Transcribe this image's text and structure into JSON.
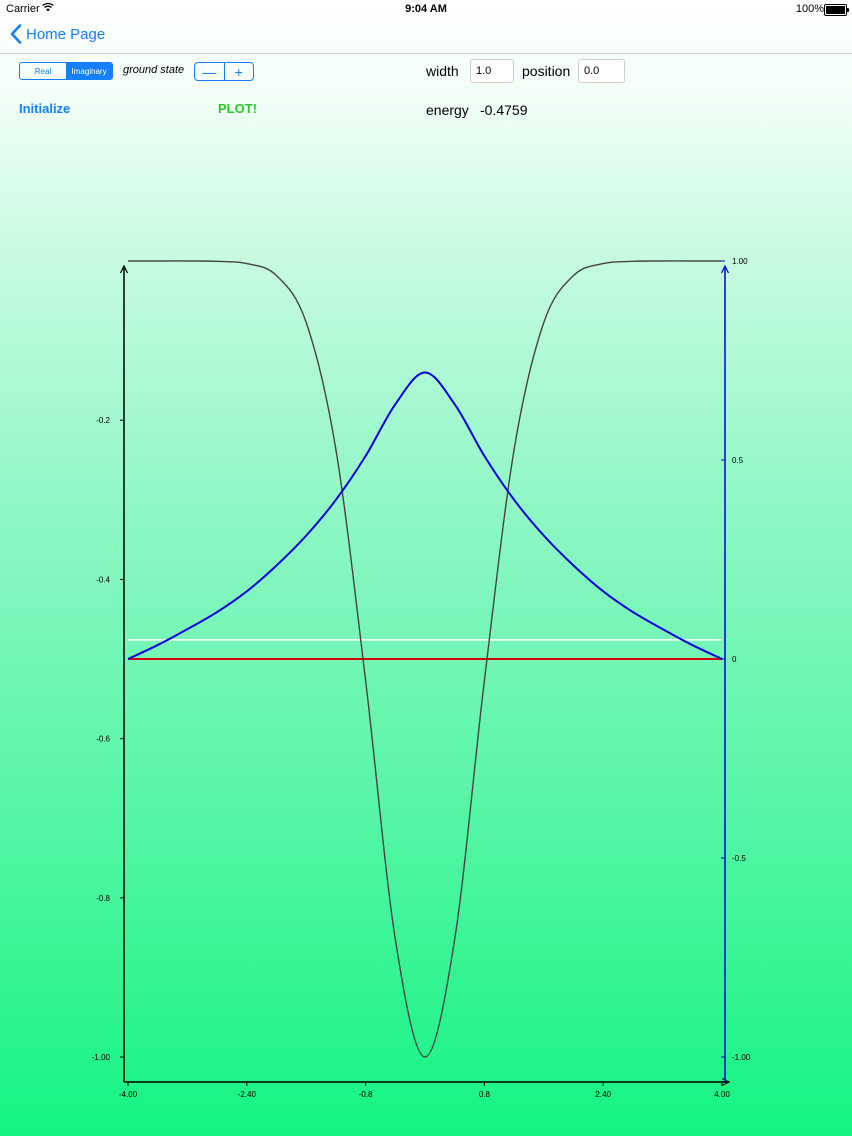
{
  "status_bar": {
    "carrier": "Carrier",
    "time": "9:04 AM",
    "battery": "100%"
  },
  "nav": {
    "back_label": "Home Page"
  },
  "controls": {
    "segment_real": "Real",
    "segment_imaginary": "Imaginary",
    "selected_segment": "Imaginary",
    "ground_state_label": "ground state",
    "stepper_minus": "—",
    "stepper_plus": "+",
    "width_label": "width",
    "width_value": "1.0",
    "position_label": "position",
    "position_value": "0.0",
    "initialize_label": "Initialize",
    "plot_label": "PLOT!",
    "energy_label": "energy",
    "energy_value": "-0.4759"
  },
  "colors": {
    "accent": "#147efb",
    "plot_button": "#28c828",
    "potential_curve": "#444444",
    "wavefunction_curve": "#0000dd",
    "zero_line": "#dd0000",
    "energy_line": "#ffffff"
  },
  "chart_data": {
    "type": "line",
    "x_tick_labels": [
      "-4.00",
      "-2.40",
      "-0.8",
      "0.8",
      "2.40",
      "4.00"
    ],
    "x_ticks": [
      -4.0,
      -2.4,
      -0.8,
      0.8,
      2.4,
      4.0
    ],
    "xlim": [
      -4.0,
      4.0
    ],
    "left_axis": {
      "tick_labels": [
        "-0.2",
        "-0.4",
        "-0.6",
        "-0.8",
        "-1.00"
      ],
      "ticks": [
        -0.2,
        -0.4,
        -0.6,
        -0.8,
        -1.0
      ],
      "ylim": [
        -1.0,
        0.0
      ]
    },
    "right_axis": {
      "tick_labels": [
        "1.00",
        "0.5",
        "0",
        "-0.5",
        "-1.00"
      ],
      "ticks": [
        1.0,
        0.5,
        0.0,
        -0.5,
        -1.0
      ],
      "ylim": [
        -1.0,
        1.0
      ],
      "color": "#0000dd"
    },
    "series": [
      {
        "axis": "left",
        "color": "#444444",
        "x": [
          -4.0,
          -3.6,
          -3.2,
          -2.8,
          -2.4,
          -2.0,
          -1.6,
          -1.2,
          -0.8,
          -0.4,
          0.0,
          0.4,
          0.8,
          1.2,
          1.6,
          2.0,
          2.4,
          2.8,
          3.2,
          3.6,
          4.0
        ],
        "values": [
          0.0,
          0.0,
          0.0,
          -0.0004,
          -0.0032,
          -0.0183,
          -0.0773,
          -0.237,
          -0.527,
          -0.852,
          -1.0,
          -0.852,
          -0.527,
          -0.237,
          -0.0773,
          -0.0183,
          -0.0032,
          -0.0004,
          0.0,
          0.0,
          0.0
        ]
      },
      {
        "axis": "right",
        "color": "#0000dd",
        "x": [
          -4.0,
          -3.6,
          -3.2,
          -2.8,
          -2.4,
          -2.0,
          -1.6,
          -1.2,
          -0.8,
          -0.4,
          0.0,
          0.4,
          0.8,
          1.2,
          1.6,
          2.0,
          2.4,
          2.8,
          3.2,
          3.6,
          4.0
        ],
        "values": [
          0.0,
          0.035,
          0.075,
          0.118,
          0.17,
          0.235,
          0.31,
          0.4,
          0.51,
          0.64,
          0.72,
          0.64,
          0.51,
          0.4,
          0.31,
          0.235,
          0.17,
          0.118,
          0.075,
          0.035,
          0.0
        ]
      },
      {
        "axis": "right",
        "color": "#dd0000",
        "x": [
          -4.0,
          4.0
        ],
        "values": [
          0.0,
          0.0
        ]
      },
      {
        "axis": "left",
        "color": "#ffffff",
        "x": [
          -4.0,
          4.0
        ],
        "values": [
          -0.4759,
          -0.4759
        ]
      }
    ]
  }
}
